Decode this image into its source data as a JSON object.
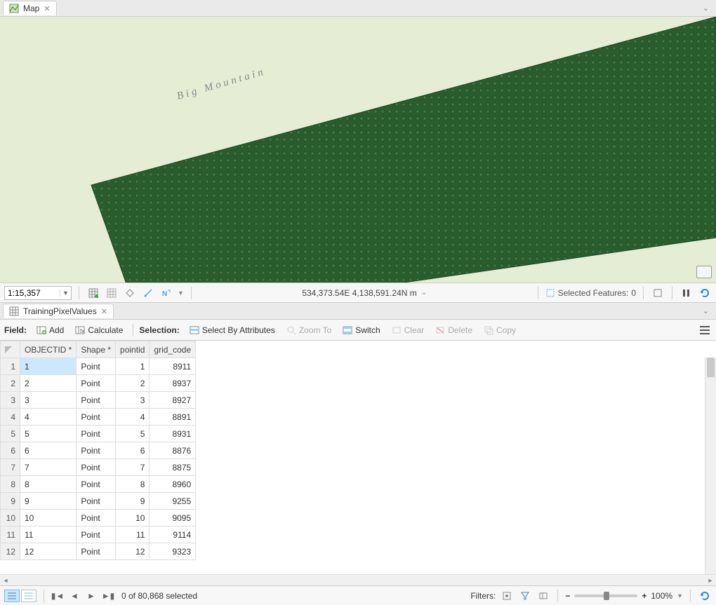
{
  "mapTab": {
    "title": "Map"
  },
  "map": {
    "label": "Big Mountain"
  },
  "mapStatus": {
    "scale": "1:15,357",
    "coords": "534,373.54E 4,138,591.24N m",
    "selectedFeaturesLabel": "Selected Features:",
    "selectedFeaturesCount": "0"
  },
  "tableTab": {
    "title": "TrainingPixelValues"
  },
  "tableToolbar": {
    "fieldLabel": "Field:",
    "add": "Add",
    "calculate": "Calculate",
    "selectionLabel": "Selection:",
    "selectByAttr": "Select By Attributes",
    "zoomTo": "Zoom To",
    "switch": "Switch",
    "clear": "Clear",
    "delete": "Delete",
    "copy": "Copy"
  },
  "columns": [
    "OBJECTID *",
    "Shape *",
    "pointid",
    "grid_code"
  ],
  "rows": [
    {
      "n": "1",
      "objectid": "1",
      "shape": "Point",
      "pointid": "1",
      "grid_code": "8911"
    },
    {
      "n": "2",
      "objectid": "2",
      "shape": "Point",
      "pointid": "2",
      "grid_code": "8937"
    },
    {
      "n": "3",
      "objectid": "3",
      "shape": "Point",
      "pointid": "3",
      "grid_code": "8927"
    },
    {
      "n": "4",
      "objectid": "4",
      "shape": "Point",
      "pointid": "4",
      "grid_code": "8891"
    },
    {
      "n": "5",
      "objectid": "5",
      "shape": "Point",
      "pointid": "5",
      "grid_code": "8931"
    },
    {
      "n": "6",
      "objectid": "6",
      "shape": "Point",
      "pointid": "6",
      "grid_code": "8876"
    },
    {
      "n": "7",
      "objectid": "7",
      "shape": "Point",
      "pointid": "7",
      "grid_code": "8875"
    },
    {
      "n": "8",
      "objectid": "8",
      "shape": "Point",
      "pointid": "8",
      "grid_code": "8960"
    },
    {
      "n": "9",
      "objectid": "9",
      "shape": "Point",
      "pointid": "9",
      "grid_code": "9255"
    },
    {
      "n": "10",
      "objectid": "10",
      "shape": "Point",
      "pointid": "10",
      "grid_code": "9095"
    },
    {
      "n": "11",
      "objectid": "11",
      "shape": "Point",
      "pointid": "11",
      "grid_code": "9114"
    },
    {
      "n": "12",
      "objectid": "12",
      "shape": "Point",
      "pointid": "12",
      "grid_code": "9323"
    }
  ],
  "footer": {
    "status": "0 of 80,868 selected",
    "filtersLabel": "Filters:",
    "zoom": "100%"
  }
}
